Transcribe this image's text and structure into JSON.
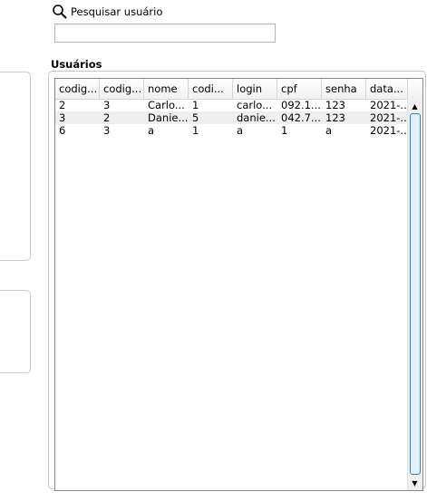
{
  "search": {
    "label": "Pesquisar usuário",
    "value": "",
    "icon": "search-icon"
  },
  "users_group": {
    "title": "Usuários"
  },
  "table": {
    "columns": [
      "codig...",
      "codig...",
      "nome",
      "codi...",
      "login",
      "cpf",
      "senha",
      "data..."
    ],
    "rows": [
      [
        "2",
        "3",
        "Carlo...",
        "1",
        "carlo...",
        "092.1...",
        "123",
        "2021-..."
      ],
      [
        "3",
        "2",
        "Danie...",
        "5",
        "danie...",
        "042.7...",
        "123",
        "2021-..."
      ],
      [
        "6",
        "3",
        "a",
        "1",
        "a",
        "1",
        "a",
        "2021-..."
      ]
    ]
  },
  "colors": {
    "scroll_thumb_border": "#3c7fb1",
    "alt_row": "#efefef"
  }
}
